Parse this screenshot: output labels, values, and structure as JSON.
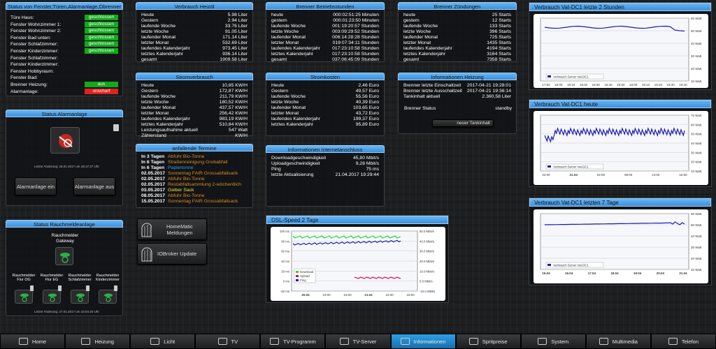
{
  "status": {
    "title": "Status von Fenster,Türen,Alarmanlage,Öbrenner",
    "rows": [
      {
        "label": "Türe Haus:",
        "value": "geschlossen",
        "color": "green"
      },
      {
        "label": "Fenster Wohnzimmer 1:",
        "value": "geschlossen",
        "color": "green"
      },
      {
        "label": "Fenster Wohnzimmer 2:",
        "value": "geschlossen",
        "color": "green"
      },
      {
        "label": "Fenster Bad unten:",
        "value": "geschlossen",
        "color": "green"
      },
      {
        "label": "Fenster Schlafzimmer:",
        "value": "geschlossen",
        "color": "green"
      },
      {
        "label": "Fenster Kinderzimmer:",
        "value": "geschlossen",
        "color": "green"
      },
      {
        "label": "Fenster Schlafzimmer:",
        "value": "",
        "color": ""
      },
      {
        "label": "Fenster Kinderzimmer:",
        "value": "",
        "color": ""
      },
      {
        "label": "Fenster Hobbyraum:",
        "value": "",
        "color": ""
      },
      {
        "label": "Fenster Bad:",
        "value": "",
        "color": ""
      },
      {
        "label": "Brenner Heizung:",
        "value": "aus",
        "color": "green"
      },
      {
        "label": "Alarmanlage:",
        "value": "unscharf",
        "color": "red"
      }
    ]
  },
  "alarm": {
    "title": "Status Alarmanlage",
    "last": "Letzte Änderung: 25.01.2017 um 18:17:37 Uhr",
    "btn_on": "Alarmanlage ein",
    "btn_off": "Alarmanlage aus"
  },
  "smoke": {
    "title": "Status Rauchmeldeanlage",
    "gateway": "Rauchmelder Gateway",
    "sensors": [
      "Rauchmelder Flur OG",
      "Rauchmelder Flur EG",
      "Rauchmelder Schlafzimmer",
      "Rauchmelder Kinderzimmer"
    ],
    "last": "Letzte Änderung: 27.01.2017 um 15:04:25 Uhr"
  },
  "oil": {
    "title": "Verbrauch Heizöl",
    "rows": [
      [
        "Heute",
        "5.98 Liter"
      ],
      [
        "Gestern",
        "2.94 Liter"
      ],
      [
        "laufende Woche",
        "33.76 Liter"
      ],
      [
        "letzte Woche",
        "91.05 Liter"
      ],
      [
        "laufender Monat",
        "171.14 Liter"
      ],
      [
        "letzter Monat",
        "532.69 Liter"
      ],
      [
        "laufendes Kalenderjahr",
        "973.45 Liter"
      ],
      [
        "letztes Kalenderjahr",
        "936.14 Liter"
      ],
      [
        "gesamt",
        "1909.58 Liter"
      ]
    ]
  },
  "hours": {
    "title": "Brenner Betriebsstunden",
    "rows": [
      [
        "heute",
        "000:02:51:25 Minuten"
      ],
      [
        "gestern",
        "000:01:23:50 Minuten"
      ],
      [
        "laufende Woche",
        "001:19:20:57 Stunden"
      ],
      [
        "letzte Woche",
        "003:09:29:52 Stunden"
      ],
      [
        "laufender Monat",
        "006:14:28:28 Stunden"
      ],
      [
        "letzter Monat",
        "019:07:34:11 Stunden"
      ],
      [
        "laufendes Kalenderjahr",
        "017:23:10:58 Stunden"
      ],
      [
        "letztes Kalenderjahr",
        "017:23:10:58 Stunden"
      ],
      [
        "gesamt",
        "037:06:45:09 Stunden"
      ]
    ]
  },
  "ignitions": {
    "title": "Brenner Zündungen",
    "rows": [
      [
        "heute",
        "25 Starts"
      ],
      [
        "gestern",
        "12 Starts"
      ],
      [
        "laufende Woche",
        "133 Starts"
      ],
      [
        "letzte Woche",
        "396 Starts"
      ],
      [
        "laufender Monat",
        "725 Starts"
      ],
      [
        "letzter Monat",
        "1435 Starts"
      ],
      [
        "laufendes Kalenderjahr",
        "4194 Starts"
      ],
      [
        "letztes Kalenderjahr",
        "3164 Starts"
      ],
      [
        "gesamt",
        "7358 Starts"
      ]
    ]
  },
  "power": {
    "title": "Stromverbrauch",
    "rows": [
      [
        "Heute",
        "10,85 KW/H"
      ],
      [
        "Gestern",
        "172,87 KW/H"
      ],
      [
        "laufende Woche",
        "211,79 KW/H"
      ],
      [
        "letzte Woche",
        "180,52 KW/H"
      ],
      [
        "laufender Monat",
        "437,57 KW/H"
      ],
      [
        "letzter Monat",
        "256,42 KW/H"
      ],
      [
        "laufendes Kalenderjahr",
        "983,19 KW/H"
      ],
      [
        "letztes Kalenderjahr",
        "510,84 KW/H"
      ],
      [
        "Leistungsaufnahme aktuell",
        "547 Watt"
      ],
      [
        "Zählerstand",
        "KW/H"
      ]
    ]
  },
  "cost": {
    "title": "Stromkosten",
    "rows": [
      [
        "Heute",
        "2,46 Euro"
      ],
      [
        "Gestern",
        "49,57 Euro"
      ],
      [
        "laufende Woche",
        "55,56 Euro"
      ],
      [
        "letzte Woche",
        "40,39 Euro"
      ],
      [
        "laufender Monat",
        "103,65 Euro"
      ],
      [
        "letzter Monat",
        "43,72 Euro"
      ],
      [
        "laufendes Kalenderjahr",
        "199,37 Euro"
      ],
      [
        "letztes Kalenderjahr",
        "95,89 Euro"
      ]
    ]
  },
  "heating": {
    "title": "Informationen Heizung",
    "rows": [
      [
        "Brenner letzte Einschaltzeit",
        "2017-04-21 19:28:01"
      ],
      [
        "Brenner letzte Ausschaltzeit",
        "2017-04-21 19:36:14"
      ],
      [
        "Tankinhalt aktuell",
        "2.360,58 Liter"
      ]
    ],
    "status_label": "Brenner Status",
    "status_value": "standby",
    "tank_btn": "neuer Tankinhalt"
  },
  "events": {
    "title": "anfallende Termine",
    "rows": [
      {
        "when": "In 3 Tagen",
        "what": "Abfuhr Bio-Tonne",
        "color": "#e08a1e"
      },
      {
        "when": "In 6 Tagen",
        "what": "Straßenreinigung Grobabfall",
        "color": "#e08a1e"
      },
      {
        "when": "In 6 Tagen",
        "what": "Papiertonne",
        "color": "#2f9de8"
      },
      {
        "when": "02.05.2017",
        "what": "Sonnentag FAIR Grossabfallsack",
        "color": "#e08a1e"
      },
      {
        "when": "02.05.2017",
        "what": "Abfuhr Bio-Tonne",
        "color": "#e08a1e"
      },
      {
        "when": "02.05.2017",
        "what": "Restabfallsammlung 2-wöchentlich",
        "color": "#e08a1e"
      },
      {
        "when": "03.05.2017",
        "what": "Gelber Sack",
        "color": "#f0e62a"
      },
      {
        "when": "08.05.2017",
        "what": "Abfuhr Bio-Tonne",
        "color": "#e08a1e"
      },
      {
        "when": "15.05.2017",
        "what": "Sonnentag FAIR Grossabfallsack",
        "color": "#e08a1e"
      }
    ]
  },
  "internet": {
    "title": "Informationen Internetanschluss",
    "rows": [
      [
        "Downloadgeschwindigkeit",
        "45,80 Mbit/s"
      ],
      [
        "Uploadgeschwindigkeit",
        "9,28 Mbit/s"
      ],
      [
        "Ping",
        "75 ms"
      ],
      [
        "letzte Aktualisierung",
        "21.04.2017 19:29:44"
      ]
    ]
  },
  "links": [
    {
      "label": "HomeMatic Meldungen"
    },
    {
      "label": "IOBroker Update"
    }
  ],
  "dsl": {
    "title": "DSL-Speed 2 Tage",
    "legend": [
      "Download",
      "Upload",
      "Ping"
    ],
    "xticks": [
      "20.04",
      "10:00",
      "16:00",
      "21.04",
      "10:00",
      "16:00"
    ],
    "ylabels_left": [
      "100 ms",
      "80 ms",
      "60 ms",
      "40 ms",
      "20 ms",
      "0 ms",
      "-20 ms"
    ],
    "ylabels_right": [
      "50.0 Mbit/s",
      "40.0 Mbit/s",
      "30.0 Mbit/s",
      "20.0 Mbit/s",
      "10.0 Mbit/s",
      "0.0 Mbit/s",
      "-10.0 Mbit/s"
    ]
  },
  "vat1": {
    "title": "Verbrauch Vat-DC1 letzte 2 Stunden",
    "legend": "Verbrauch Server Vat-DC1",
    "xticks": [
      "17:50",
      "18:00",
      "18:10",
      "18:20",
      "18:30",
      "18:40",
      "18:50",
      "19:00",
      "19:10",
      "19:20",
      "19:30",
      "19:40"
    ],
    "yticks": [
      "60 Watt",
      "50 Watt",
      "40 Watt",
      "30 Watt",
      "20 Watt",
      "10 Watt"
    ]
  },
  "vat2": {
    "title": "Verbrauch Vat-DC1 heute",
    "legend": "Verbrauch Server Vat-DC1",
    "xticks": [
      "22:00",
      "21.04",
      "02:00",
      "08:00",
      "14:00",
      "16:00"
    ],
    "yticks": [
      "70 Watt",
      "60 Watt",
      "50 Watt",
      "40 Watt",
      "30 Watt",
      "20 Watt",
      "10 Watt"
    ]
  },
  "vat3": {
    "title": "Verbrauch Vat-DC1 letzten 7 Tage",
    "legend": "Verbrauch Server Vat-DC1",
    "xticks": [
      "15.04",
      "16.04",
      "17.04",
      "18.04",
      "19.04",
      "20.04",
      "21.04"
    ],
    "yticks": [
      "60 Watt",
      "50 Watt",
      "40 Watt",
      "30 Watt",
      "20 Watt",
      "10 Watt"
    ]
  },
  "nav": [
    "Home",
    "Heizung",
    "Licht",
    "TV",
    "TV-Programm",
    "TV-Server",
    "Informationen",
    "Spritpreise",
    "System",
    "Multimedia",
    "Telefon"
  ],
  "colors": {
    "accent": "#4aa2ec",
    "green": "#12a91b",
    "red": "#e0231c"
  }
}
